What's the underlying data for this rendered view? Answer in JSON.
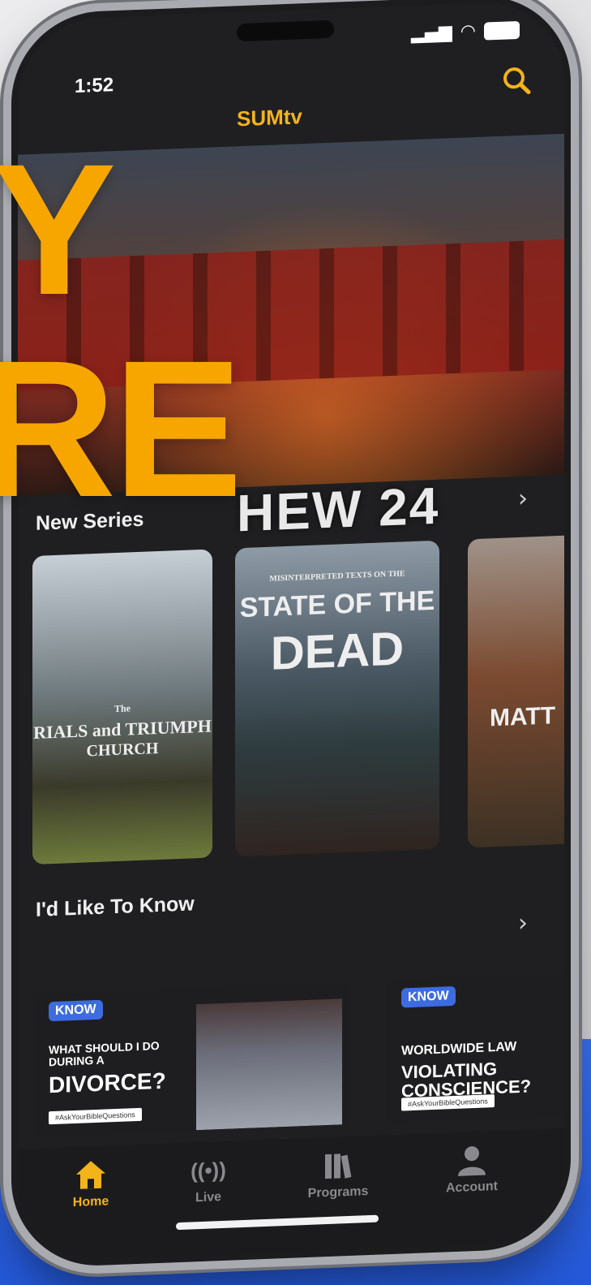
{
  "status_bar": {
    "time": "1:52"
  },
  "header": {
    "title": "SUMtv"
  },
  "hero": {
    "title": "HEW 24"
  },
  "overlay": {
    "line1": "Y",
    "line2": "RE"
  },
  "sections": {
    "new_series": {
      "title": "New Series"
    },
    "like_to_know": {
      "title": "I'd Like To Know"
    }
  },
  "posters": [
    {
      "title": "RIALS and TRIUMPH",
      "subtitle": "CHURCH",
      "the": "The"
    },
    {
      "title": "STATE OF THE",
      "subtitle": "DEAD",
      "kicker": "MISINTERPRETED TEXTS ON THE"
    },
    {
      "title": "MATT"
    }
  ],
  "know_cards": [
    {
      "badge": "KNOW",
      "q_small": "WHAT SHOULD I DO DURING A",
      "q_big": "DIVORCE?",
      "tag": "#AskYourBibleQuestions"
    },
    {
      "badge": "KNOW",
      "q_small": "WORLDWIDE LAW",
      "q_big": "VIOLATING CONSCIENCE?",
      "tag": "#AskYourBibleQuestions"
    }
  ],
  "nav": {
    "home": "Home",
    "live": "Live",
    "programs": "Programs",
    "account": "Account"
  },
  "colors": {
    "accent": "#f3b31a",
    "overlay": "#f7a600",
    "bg_blue": "#2a5fe3"
  },
  "icons": [
    "search-icon",
    "home-icon",
    "live-icon",
    "programs-icon",
    "account-icon",
    "chevron-right-icon"
  ]
}
